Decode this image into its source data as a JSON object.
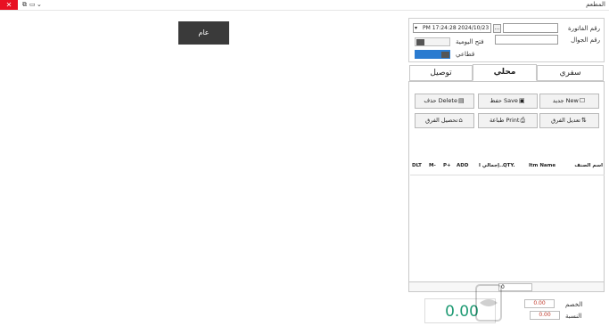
{
  "window": {
    "title": "المطعم",
    "close_label": "✕",
    "restore_label": "⧉",
    "minimize_label": "▭",
    "extra_label": "⌄"
  },
  "category": {
    "label": "عام"
  },
  "header": {
    "invoice_number_label": "رقم الفاتورة",
    "datetime_value": "PM 17:24:28 2024/10/23",
    "phone_label": "رقم الجوال",
    "ellipsis_label": "...",
    "daily_open_label": "فتح اليومية",
    "sector_label": "قطاعي",
    "daily_open_toggle": false,
    "sector_toggle": true
  },
  "tabs": [
    {
      "label": "سفري",
      "active": false
    },
    {
      "label": "محلي",
      "active": true
    },
    {
      "label": "توصيل",
      "active": false
    }
  ],
  "actions": {
    "new_label": "جديد New",
    "save_label": "حفظ Save",
    "delete_label": "حذف Delete",
    "transfer_label": "تعديل الفرق",
    "print_label": "طباعة Print",
    "collect_label": "تحصيل الفرق"
  },
  "grid": {
    "columns": [
      "اسم الصنف",
      "Itm Name",
      "QTY.",
      "إجمالي ا...",
      "ADD",
      "P+",
      "M-",
      "DLT"
    ]
  },
  "footer": {
    "qty_value": "0",
    "discount_label": "الخصم",
    "discount_value": "0.00",
    "percent_label": "النسبة",
    "percent_value": "0.00",
    "total_value": "0.00"
  },
  "colors": {
    "accent_total": "#1e9a73",
    "category_bg": "#3a3a3a",
    "toggle_on": "#2a7bd0",
    "close_red": "#e81123"
  }
}
